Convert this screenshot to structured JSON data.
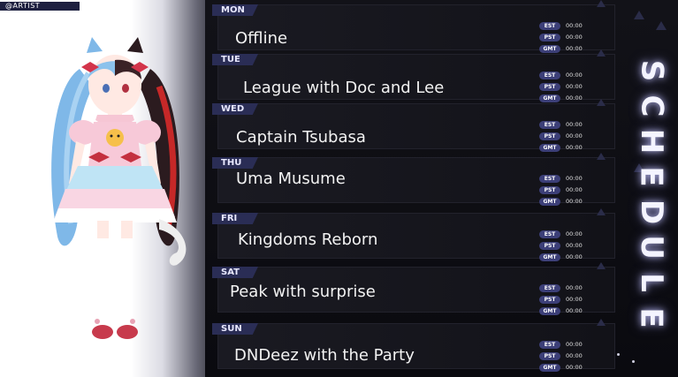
{
  "artist_tag": "@ARTIST",
  "title": [
    "S",
    "C",
    "H",
    "E",
    "D",
    "U",
    "L",
    "E"
  ],
  "schedule": [
    {
      "day": "MON",
      "event": "Offline",
      "times": [
        {
          "tz": "EST",
          "time": "00:00"
        },
        {
          "tz": "PST",
          "time": "00:00"
        },
        {
          "tz": "GMT",
          "time": "00:00"
        }
      ]
    },
    {
      "day": "TUE",
      "event": "League with Doc and Lee",
      "times": [
        {
          "tz": "EST",
          "time": "00:00"
        },
        {
          "tz": "PST",
          "time": "00:00"
        },
        {
          "tz": "GMT",
          "time": "00:00"
        }
      ]
    },
    {
      "day": "WED",
      "event": "Captain Tsubasa",
      "times": [
        {
          "tz": "EST",
          "time": "00:00"
        },
        {
          "tz": "PST",
          "time": "00:00"
        },
        {
          "tz": "GMT",
          "time": "00:00"
        }
      ]
    },
    {
      "day": "THU",
      "event": "Uma Musume",
      "times": [
        {
          "tz": "EST",
          "time": "00:00"
        },
        {
          "tz": "PST",
          "time": "00:00"
        },
        {
          "tz": "GMT",
          "time": "00:00"
        }
      ]
    },
    {
      "day": "FRI",
      "event": "Kingdoms Reborn",
      "times": [
        {
          "tz": "EST",
          "time": "00:00"
        },
        {
          "tz": "PST",
          "time": "00:00"
        },
        {
          "tz": "GMT",
          "time": "00:00"
        }
      ]
    },
    {
      "day": "SAT",
      "event": "Peak with surprise",
      "times": [
        {
          "tz": "EST",
          "time": "00:00"
        },
        {
          "tz": "PST",
          "time": "00:00"
        },
        {
          "tz": "GMT",
          "time": "00:00"
        }
      ]
    },
    {
      "day": "SUN",
      "event": "DNDeez with the Party",
      "times": [
        {
          "tz": "EST",
          "time": "00:00"
        },
        {
          "tz": "PST",
          "time": "00:00"
        },
        {
          "tz": "GMT",
          "time": "00:00"
        }
      ]
    }
  ]
}
